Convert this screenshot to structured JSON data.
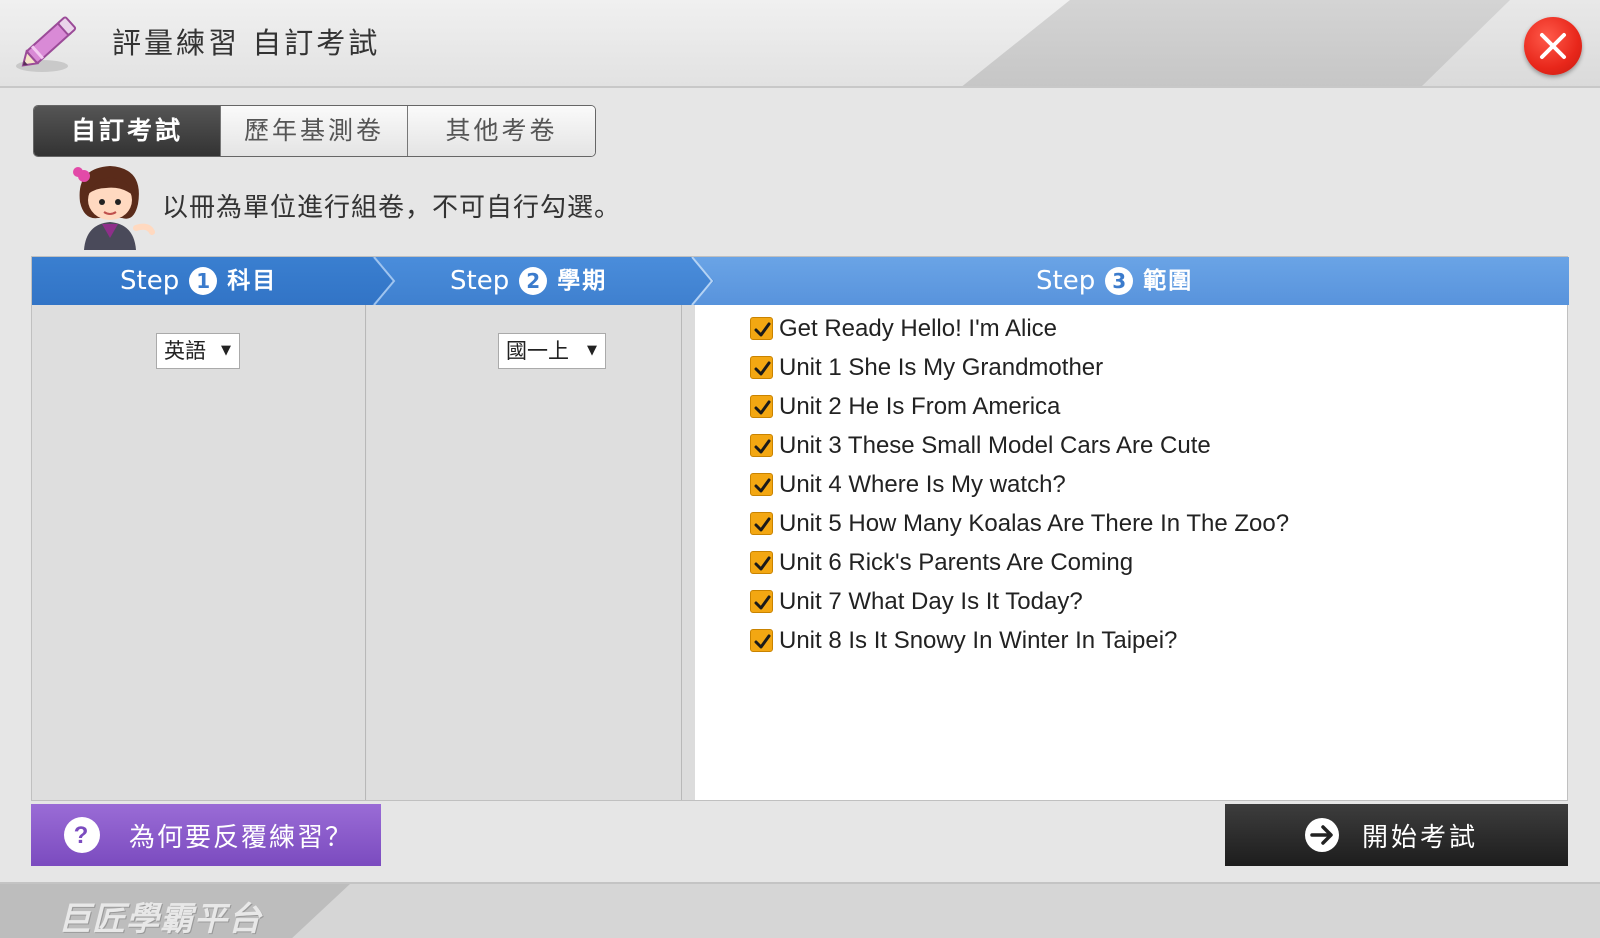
{
  "app": {
    "title": "評量練習 自訂考試"
  },
  "tabs": [
    {
      "label": "自訂考試",
      "active": true
    },
    {
      "label": "歷年基測卷",
      "active": false
    },
    {
      "label": "其他考卷",
      "active": false
    }
  ],
  "instruction": "以冊為單位進行組卷，不可自行勾選。",
  "steps": [
    {
      "word": "Step",
      "number": "1",
      "label": "科目"
    },
    {
      "word": "Step",
      "number": "2",
      "label": "學期"
    },
    {
      "word": "Step",
      "number": "3",
      "label": "範圍"
    }
  ],
  "subject_select": {
    "value": "英語"
  },
  "term_select": {
    "value": "國一上"
  },
  "units": [
    {
      "label": "Get Ready Hello! I'm Alice",
      "checked": true
    },
    {
      "label": "Unit 1 She Is My Grandmother",
      "checked": true
    },
    {
      "label": "Unit 2 He Is From America",
      "checked": true
    },
    {
      "label": "Unit 3 These Small Model Cars Are Cute",
      "checked": true
    },
    {
      "label": "Unit 4 Where Is My watch?",
      "checked": true
    },
    {
      "label": "Unit 5 How Many Koalas Are There In The Zoo?",
      "checked": true
    },
    {
      "label": "Unit 6 Rick's Parents Are Coming",
      "checked": true
    },
    {
      "label": "Unit 7 What Day Is It Today?",
      "checked": true
    },
    {
      "label": "Unit 8 Is It Snowy In Winter In Taipei?",
      "checked": true
    }
  ],
  "buttons": {
    "why_label": "為何要反覆練習？",
    "start_label": "開始考試"
  },
  "footer": {
    "brand": "巨匠學霸平台"
  },
  "colors": {
    "step_blue": "#3f84d4",
    "checkbox_orange": "#f3a712",
    "close_red": "#e8271b",
    "why_purple": "#8a5bcb",
    "start_dark": "#2a2a2a"
  },
  "icons": [
    "pencil-icon",
    "close-icon",
    "mascot-icon",
    "check-icon",
    "help-icon",
    "arrow-right-icon"
  ]
}
